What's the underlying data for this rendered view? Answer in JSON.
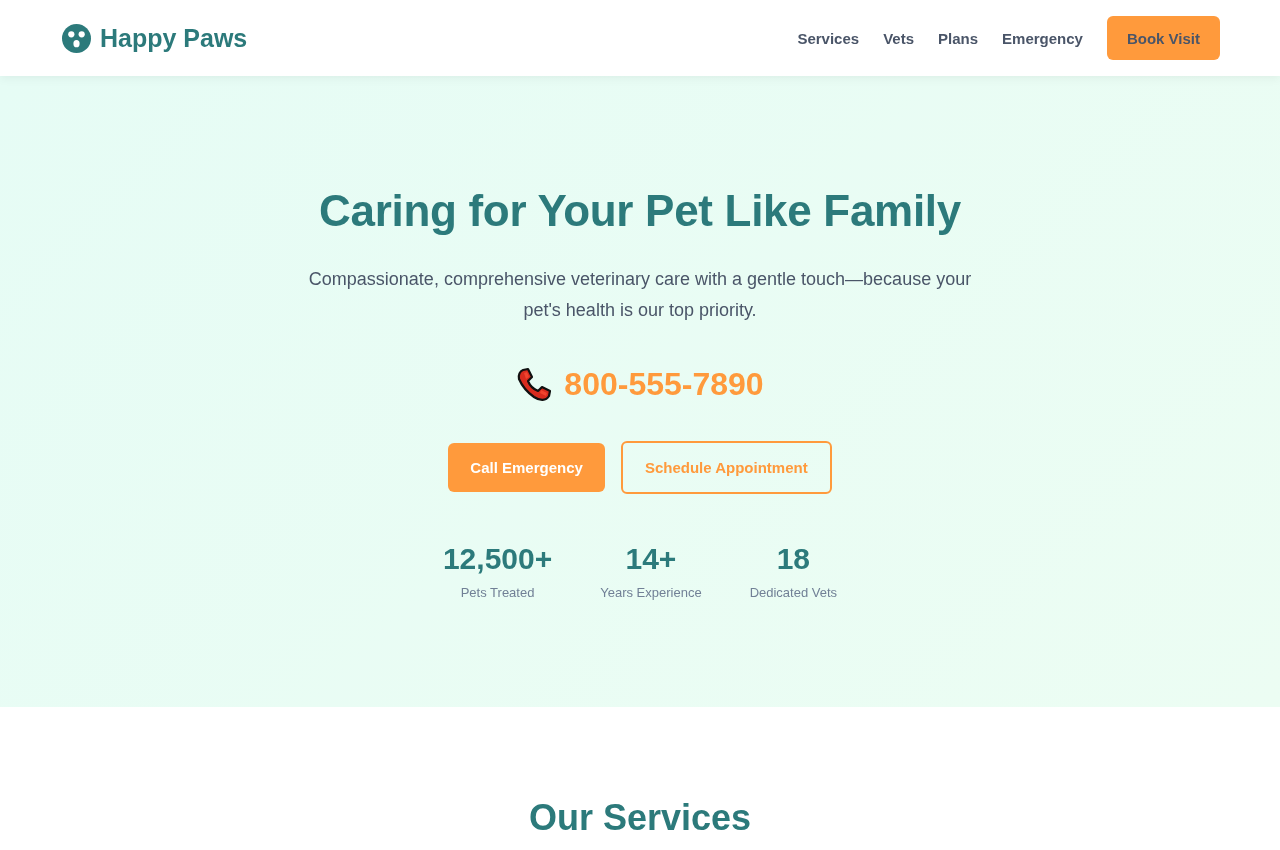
{
  "header": {
    "logo": "Happy Paws",
    "nav": [
      "Services",
      "Vets",
      "Plans",
      "Emergency"
    ],
    "cta": "Book Visit"
  },
  "hero": {
    "title": "Caring for Your Pet Like Family",
    "subtitle": "Compassionate, comprehensive veterinary care with a gentle touch—because your pet's health is our top priority.",
    "phone": "800-555-7890",
    "buttons": [
      {
        "label": "Call Emergency",
        "kind": "primary"
      },
      {
        "label": "Schedule Appointment",
        "kind": "outline"
      }
    ],
    "stats": [
      {
        "value": "12,500+",
        "label": "Pets Treated"
      },
      {
        "value": "14+",
        "label": "Years Experience"
      },
      {
        "value": "18",
        "label": "Dedicated Vets"
      }
    ]
  },
  "services": {
    "title": "Our Services"
  }
}
